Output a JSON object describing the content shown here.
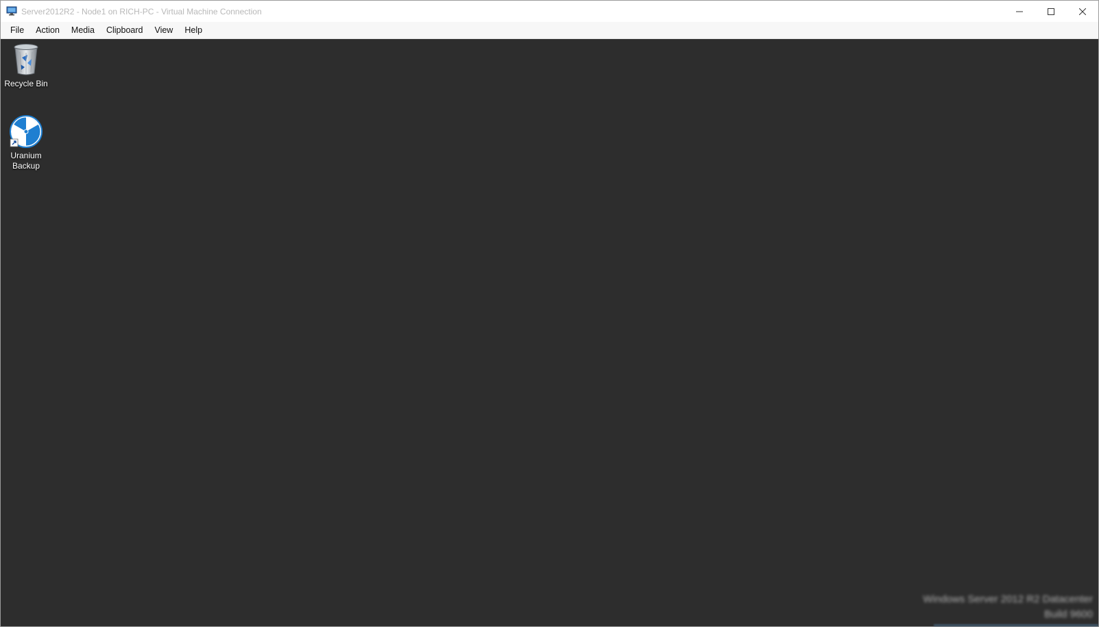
{
  "window": {
    "title": "Server2012R2 - Node1 on RICH-PC - Virtual Machine Connection",
    "controls": {
      "minimize": "minimize",
      "maximize": "maximize",
      "close": "close"
    }
  },
  "menu": {
    "items": [
      {
        "label": "File"
      },
      {
        "label": "Action"
      },
      {
        "label": "Media"
      },
      {
        "label": "Clipboard"
      },
      {
        "label": "View"
      },
      {
        "label": "Help"
      }
    ]
  },
  "desktop": {
    "background_color": "#2d2d2d",
    "icons": [
      {
        "label": "Recycle Bin",
        "icon": "recycle-bin-icon"
      },
      {
        "label": "Uranium Backup",
        "icon": "uranium-backup-icon",
        "shortcut": true
      }
    ],
    "watermark": {
      "line1": "Windows Server 2012 R2 Datacenter",
      "line2": "Build 9600"
    }
  },
  "colors": {
    "accent_blue": "#1f7fd1",
    "text_white": "#ffffff"
  }
}
